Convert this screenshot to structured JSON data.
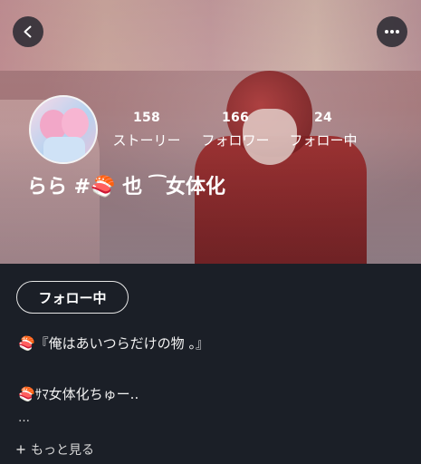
{
  "header": {
    "back_icon": "chevron-left-icon",
    "menu_icon": "more-horizontal-icon"
  },
  "profile": {
    "stats": [
      {
        "count": "158",
        "label": "ストーリー"
      },
      {
        "count": "166",
        "label": "フォロワー"
      },
      {
        "count": "24",
        "label": "フォロー中"
      }
    ],
    "name": "らら #🍣 也 ⁀女体化"
  },
  "actions": {
    "follow_label": "フォロー中"
  },
  "bio": {
    "line1": "🍣『俺はあいつらだけの物 。』",
    "line2": "🍣ｻﾏ女体化ちゅー..",
    "line3": "…"
  },
  "more": {
    "label": "もっと見る",
    "icon": "plus-icon"
  }
}
